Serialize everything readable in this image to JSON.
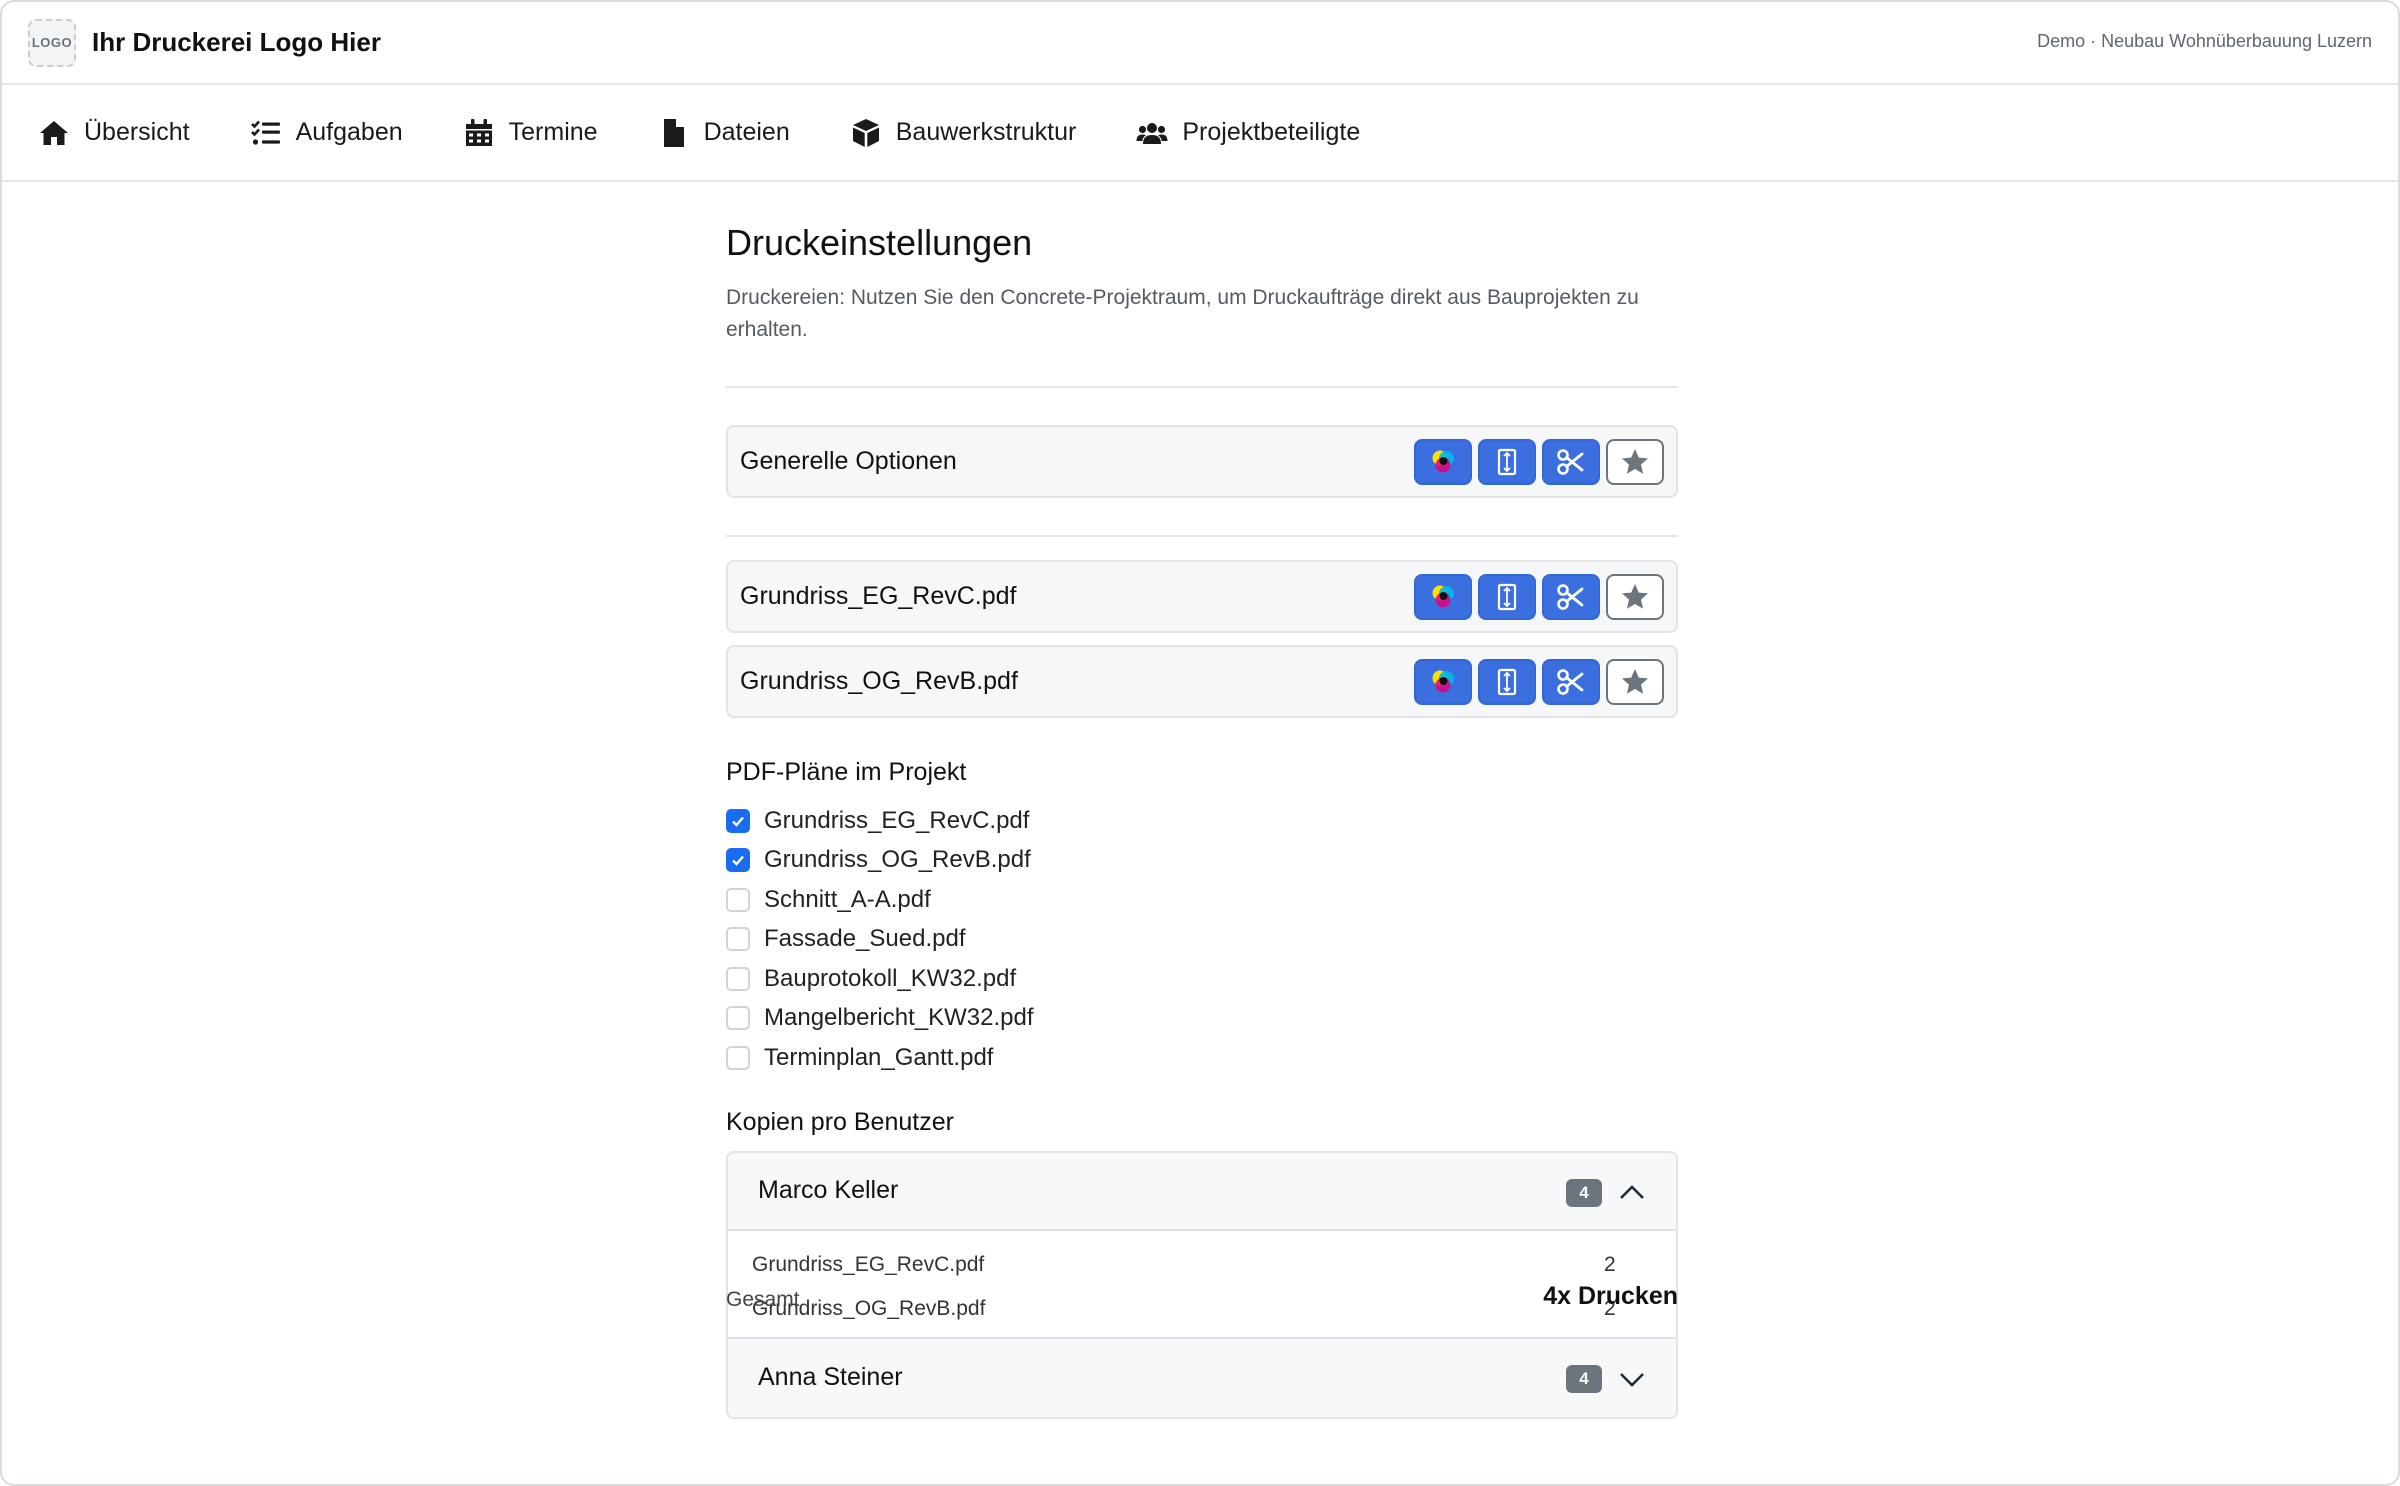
{
  "brand": {
    "logo_text": "LOGO",
    "name": "Ihr Druckerei Logo Hier"
  },
  "project_label": "Demo · Neubau Wohnüberbauung Luzern",
  "nav": [
    {
      "label": "Übersicht",
      "icon": "home-icon"
    },
    {
      "label": "Aufgaben",
      "icon": "task-list-icon"
    },
    {
      "label": "Termine",
      "icon": "calendar-icon"
    },
    {
      "label": "Dateien",
      "icon": "file-icon"
    },
    {
      "label": "Bauwerkstruktur",
      "icon": "cube-icon"
    },
    {
      "label": "Projektbeteiligte",
      "icon": "users-icon"
    }
  ],
  "page": {
    "title": "Druckeinstellungen",
    "description": "Druckereien: Nutzen Sie den Concrete-Projektraum, um Druckaufträge direkt aus Bauprojekten zu erhalten."
  },
  "general_options": {
    "label": "Generelle Optionen"
  },
  "option_buttons": [
    "color-icon",
    "paper-format-icon",
    "scissors-icon",
    "star-icon"
  ],
  "file_options": [
    {
      "label": "Grundriss_EG_RevC.pdf"
    },
    {
      "label": "Grundriss_OG_RevB.pdf"
    }
  ],
  "pdf_section": {
    "heading": "PDF-Pläne im Projekt",
    "files": [
      {
        "label": "Grundriss_EG_RevC.pdf",
        "checked": true
      },
      {
        "label": "Grundriss_OG_RevB.pdf",
        "checked": true
      },
      {
        "label": "Schnitt_A-A.pdf",
        "checked": false
      },
      {
        "label": "Fassade_Sued.pdf",
        "checked": false
      },
      {
        "label": "Bauprotokoll_KW32.pdf",
        "checked": false
      },
      {
        "label": "Mangelbericht_KW32.pdf",
        "checked": false
      },
      {
        "label": "Terminplan_Gantt.pdf",
        "checked": false
      }
    ]
  },
  "copies_section": {
    "heading": "Kopien pro Benutzer",
    "users": [
      {
        "name": "Marco Keller",
        "count": "4",
        "expanded": true,
        "items": [
          {
            "file": "Grundriss_EG_RevC.pdf",
            "qty": "2"
          },
          {
            "file": "Grundriss_OG_RevB.pdf",
            "qty": "2"
          }
        ]
      },
      {
        "name": "Anna Steiner",
        "count": "4",
        "expanded": false,
        "items": []
      }
    ]
  },
  "total": {
    "label": "Gesamt",
    "value": "4x Drucken"
  },
  "colors": {
    "primary": "#3b6fe0",
    "checkbox": "#1a6df0",
    "badge": "#6c757d"
  }
}
